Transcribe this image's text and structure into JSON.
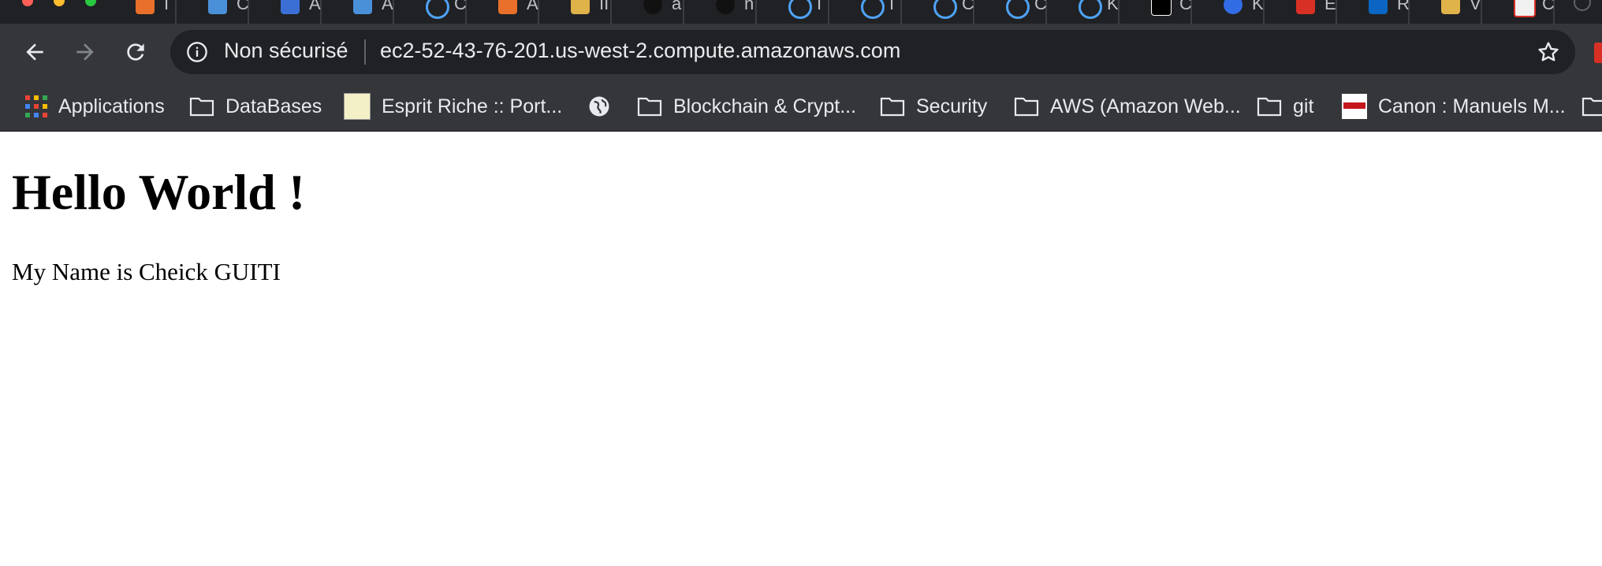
{
  "browser": {
    "security_label": "Non sécurisé",
    "url": "ec2-52-43-76-201.us-west-2.compute.amazonaws.com",
    "colors": {
      "frame": "#35363a",
      "tabstrip": "#202124",
      "omnibox": "#202124",
      "text": "#e8eaed"
    }
  },
  "tabs": [
    {
      "icon": "aws-cube-icon",
      "letter": "I"
    },
    {
      "icon": "folder-box-icon",
      "letter": "C"
    },
    {
      "icon": "cube-blue-icon",
      "letter": "A"
    },
    {
      "icon": "folder-box-icon",
      "letter": "A"
    },
    {
      "icon": "link-icon",
      "letter": "C"
    },
    {
      "icon": "aws-cube-icon",
      "letter": "A"
    },
    {
      "icon": "folder-box-icon",
      "letter": "II"
    },
    {
      "icon": "github-icon",
      "letter": "a"
    },
    {
      "icon": "github-icon",
      "letter": "n"
    },
    {
      "icon": "link-icon",
      "letter": "I"
    },
    {
      "icon": "link-icon",
      "letter": "I"
    },
    {
      "icon": "link-icon",
      "letter": "C"
    },
    {
      "icon": "link-icon",
      "letter": "C"
    },
    {
      "icon": "link-icon",
      "letter": "K"
    },
    {
      "icon": "medium-icon",
      "letter": "C"
    },
    {
      "icon": "kubernetes-icon",
      "letter": "K"
    },
    {
      "icon": "bookmark-red-icon",
      "letter": "E"
    },
    {
      "icon": "linkedin-icon",
      "letter": "R"
    },
    {
      "icon": "folder-box-icon",
      "letter": "V"
    },
    {
      "icon": "gmail-icon",
      "letter": "C"
    }
  ],
  "bookmarks": [
    {
      "label": "Applications",
      "icon": "apps-grid-icon"
    },
    {
      "label": "DataBases",
      "icon": "folder-icon"
    },
    {
      "label": "Esprit Riche :: Port...",
      "icon": "site-thumb-icon"
    },
    {
      "label": "",
      "icon": "globe-icon"
    },
    {
      "label": "Blockchain & Crypt...",
      "icon": "folder-icon"
    },
    {
      "label": "Security",
      "icon": "folder-icon"
    },
    {
      "label": "AWS (Amazon Web...",
      "icon": "folder-icon"
    },
    {
      "label": "git",
      "icon": "folder-icon"
    },
    {
      "label": "Canon : Manuels M...",
      "icon": "canon-icon"
    },
    {
      "label": "",
      "icon": "folder-icon"
    }
  ],
  "page": {
    "heading": "Hello World !",
    "text": "My Name is Cheick GUITI"
  }
}
